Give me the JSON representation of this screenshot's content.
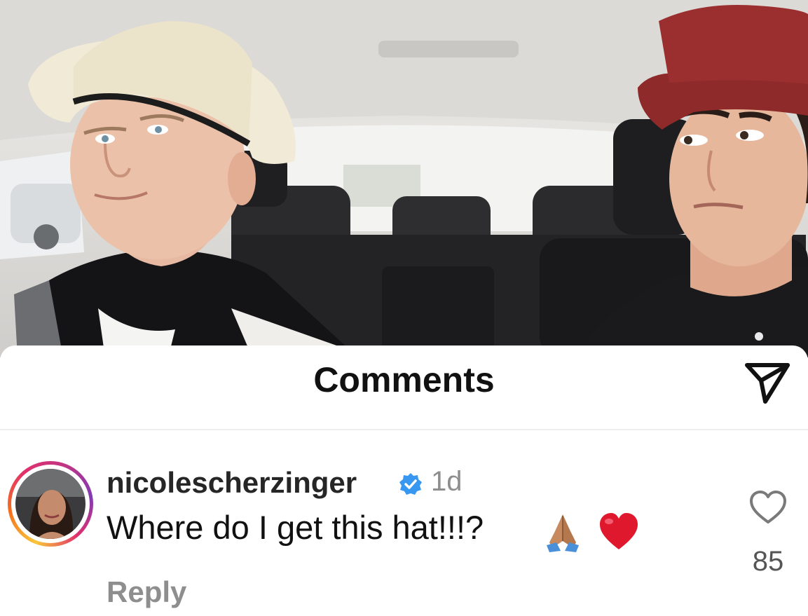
{
  "sheet": {
    "title": "Comments"
  },
  "icons": {
    "send": "paper-plane-icon",
    "verified": "verified-badge-icon",
    "like": "heart-outline-icon",
    "emoji_1": "folded-hands-emoji",
    "emoji_2": "red-heart-emoji"
  },
  "comment": {
    "username": "nicolescherzinger",
    "time": "1d",
    "text": "Where do I get this hat!!!?",
    "reply_label": "Reply",
    "like_count": "85"
  },
  "colors": {
    "verified_blue": "#3897f0",
    "heart_red": "#e0182d",
    "muted_text": "#8e8e8e"
  }
}
